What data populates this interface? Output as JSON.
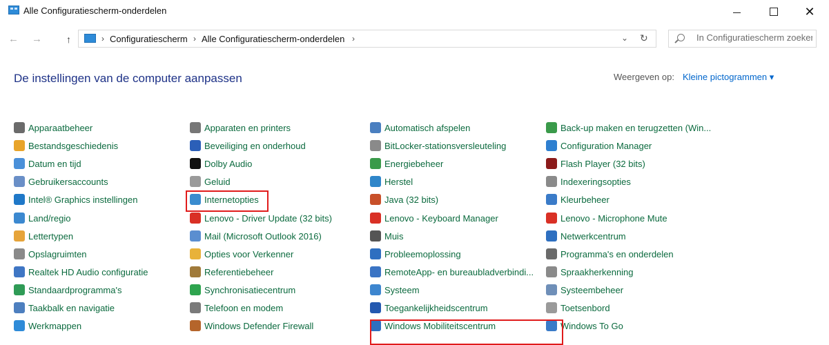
{
  "window": {
    "title": "Alle Configuratiescherm-onderdelen"
  },
  "nav": {
    "breadcrumbs": [
      "Configuratiescherm",
      "Alle Configuratiescherm-onderdelen"
    ],
    "search_placeholder": "In Configuratiescherm zoeken"
  },
  "header": {
    "title": "De instellingen van de computer aanpassen",
    "view_label": "Weergeven op:",
    "view_value": "Kleine pictogrammen ▾"
  },
  "columns": [
    [
      {
        "label": "Apparaatbeheer",
        "icon": "device-manager-icon",
        "color": "#6b6b6b"
      },
      {
        "label": "Bestandsgeschiedenis",
        "icon": "file-history-icon",
        "color": "#e8a42a"
      },
      {
        "label": "Datum en tijd",
        "icon": "date-time-icon",
        "color": "#4a90d9"
      },
      {
        "label": "Gebruikersaccounts",
        "icon": "user-accounts-icon",
        "color": "#6a8fc7"
      },
      {
        "label": "Intel® Graphics instellingen",
        "icon": "intel-graphics-icon",
        "color": "#1f78c8"
      },
      {
        "label": "Land/regio",
        "icon": "region-icon",
        "color": "#3c89d0"
      },
      {
        "label": "Lettertypen",
        "icon": "fonts-icon",
        "color": "#e6a43a"
      },
      {
        "label": "Opslagruimten",
        "icon": "storage-spaces-icon",
        "color": "#8a8a8a"
      },
      {
        "label": "Realtek HD Audio configuratie",
        "icon": "realtek-audio-icon",
        "color": "#3f76c4"
      },
      {
        "label": "Standaardprogramma's",
        "icon": "default-programs-icon",
        "color": "#2f9b56"
      },
      {
        "label": "Taakbalk en navigatie",
        "icon": "taskbar-icon",
        "color": "#4d7fbf"
      },
      {
        "label": "Werkmappen",
        "icon": "work-folders-icon",
        "color": "#2e8bd8"
      }
    ],
    [
      {
        "label": "Apparaten en printers",
        "icon": "devices-printers-icon",
        "color": "#777777"
      },
      {
        "label": "Beveiliging en onderhoud",
        "icon": "security-flag-icon",
        "color": "#2b5fb8"
      },
      {
        "label": "Dolby Audio",
        "icon": "dolby-icon",
        "color": "#111111"
      },
      {
        "label": "Geluid",
        "icon": "sound-icon",
        "color": "#9a9a9a"
      },
      {
        "label": "Internetopties",
        "icon": "internet-options-icon",
        "color": "#3a8ccf"
      },
      {
        "label": "Lenovo - Driver Update (32 bits)",
        "icon": "lenovo-driver-icon",
        "color": "#d93025"
      },
      {
        "label": "Mail (Microsoft Outlook 2016)",
        "icon": "mail-icon",
        "color": "#5a8ed0"
      },
      {
        "label": "Opties voor Verkenner",
        "icon": "explorer-options-icon",
        "color": "#e8b23a"
      },
      {
        "label": "Referentiebeheer",
        "icon": "credential-manager-icon",
        "color": "#a07a3a"
      },
      {
        "label": "Synchronisatiecentrum",
        "icon": "sync-center-icon",
        "color": "#2ea44f"
      },
      {
        "label": "Telefoon en modem",
        "icon": "phone-modem-icon",
        "color": "#7a7a7a"
      },
      {
        "label": "Windows Defender Firewall",
        "icon": "firewall-icon",
        "color": "#b5652b"
      }
    ],
    [
      {
        "label": "Automatisch afspelen",
        "icon": "autoplay-icon",
        "color": "#4a7fc0"
      },
      {
        "label": "BitLocker-stationsversleuteling",
        "icon": "bitlocker-icon",
        "color": "#8a8a8a"
      },
      {
        "label": "Energiebeheer",
        "icon": "power-icon",
        "color": "#3a9a4a"
      },
      {
        "label": "Herstel",
        "icon": "recovery-icon",
        "color": "#2f86c9"
      },
      {
        "label": "Java (32 bits)",
        "icon": "java-icon",
        "color": "#c8502a"
      },
      {
        "label": "Lenovo - Keyboard Manager",
        "icon": "lenovo-keyboard-icon",
        "color": "#d93025"
      },
      {
        "label": "Muis",
        "icon": "mouse-icon",
        "color": "#555555"
      },
      {
        "label": "Probleemoplossing",
        "icon": "troubleshoot-icon",
        "color": "#2e6fc0"
      },
      {
        "label": "RemoteApp- en bureaubladverbindi...",
        "icon": "remoteapp-icon",
        "color": "#3a74c4"
      },
      {
        "label": "Systeem",
        "icon": "system-icon",
        "color": "#3d86cf"
      },
      {
        "label": "Toegankelijkheidscentrum",
        "icon": "ease-of-access-icon",
        "color": "#2459b0"
      },
      {
        "label": "Windows Mobiliteitscentrum",
        "icon": "mobility-center-icon",
        "color": "#2e6fc0"
      }
    ],
    [
      {
        "label": "Back-up maken en terugzetten (Win...",
        "icon": "backup-icon",
        "color": "#3a9a4a"
      },
      {
        "label": "Configuration Manager",
        "icon": "configuration-manager-icon",
        "color": "#2e7fd0"
      },
      {
        "label": "Flash Player (32 bits)",
        "icon": "flash-player-icon",
        "color": "#8b1a1a"
      },
      {
        "label": "Indexeringsopties",
        "icon": "indexing-icon",
        "color": "#8a8a8a"
      },
      {
        "label": "Kleurbeheer",
        "icon": "color-management-icon",
        "color": "#3a7bc8"
      },
      {
        "label": "Lenovo - Microphone Mute",
        "icon": "microphone-mute-icon",
        "color": "#d93025"
      },
      {
        "label": "Netwerkcentrum",
        "icon": "network-center-icon",
        "color": "#2e6fc0"
      },
      {
        "label": "Programma's en onderdelen",
        "icon": "programs-features-icon",
        "color": "#6a6a6a"
      },
      {
        "label": "Spraakherkenning",
        "icon": "speech-recognition-icon",
        "color": "#8a8a8a"
      },
      {
        "label": "Systeembeheer",
        "icon": "admin-tools-icon",
        "color": "#6f8fb8"
      },
      {
        "label": "Toetsenbord",
        "icon": "keyboard-icon",
        "color": "#9a9a9a"
      },
      {
        "label": "Windows To Go",
        "icon": "windows-to-go-icon",
        "color": "#3a7bc8"
      }
    ]
  ]
}
